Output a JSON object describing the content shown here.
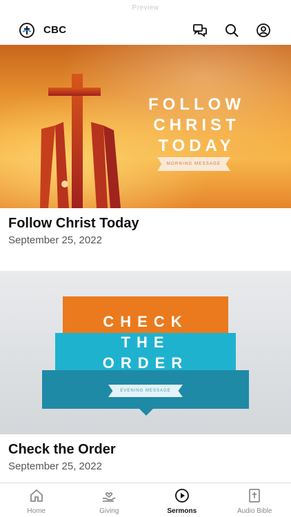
{
  "status_bar": {
    "text": "Preview"
  },
  "header": {
    "logo_icon": "church-cross-globe-icon",
    "brand": "CBC",
    "actions": [
      {
        "name": "chat-icon"
      },
      {
        "name": "search-icon"
      },
      {
        "name": "profile-icon"
      }
    ]
  },
  "sermons": [
    {
      "banner": {
        "lines": [
          "FOLLOW",
          "CHRIST",
          "TODAY"
        ],
        "ribbon": "MORNING MESSAGE"
      },
      "title": "Follow Christ Today",
      "date": "September 25, 2022"
    },
    {
      "banner": {
        "lines": [
          "CHECK",
          "THE",
          "ORDER"
        ],
        "ribbon": "EVENING MESSAGE"
      },
      "title": "Check the Order",
      "date": "September 25, 2022"
    }
  ],
  "tabs": [
    {
      "label": "Home",
      "icon": "home-icon",
      "active": false
    },
    {
      "label": "Giving",
      "icon": "giving-hand-heart-icon",
      "active": false
    },
    {
      "label": "Sermons",
      "icon": "play-circle-icon",
      "active": true
    },
    {
      "label": "Audio Bible",
      "icon": "bible-icon",
      "active": false
    }
  ],
  "colors": {
    "accent_orange": "#ea7a1d",
    "accent_cyan": "#1fb2cf",
    "accent_teal": "#1f8aa6",
    "tab_inactive": "#8a8a8a",
    "tab_active": "#111111"
  }
}
